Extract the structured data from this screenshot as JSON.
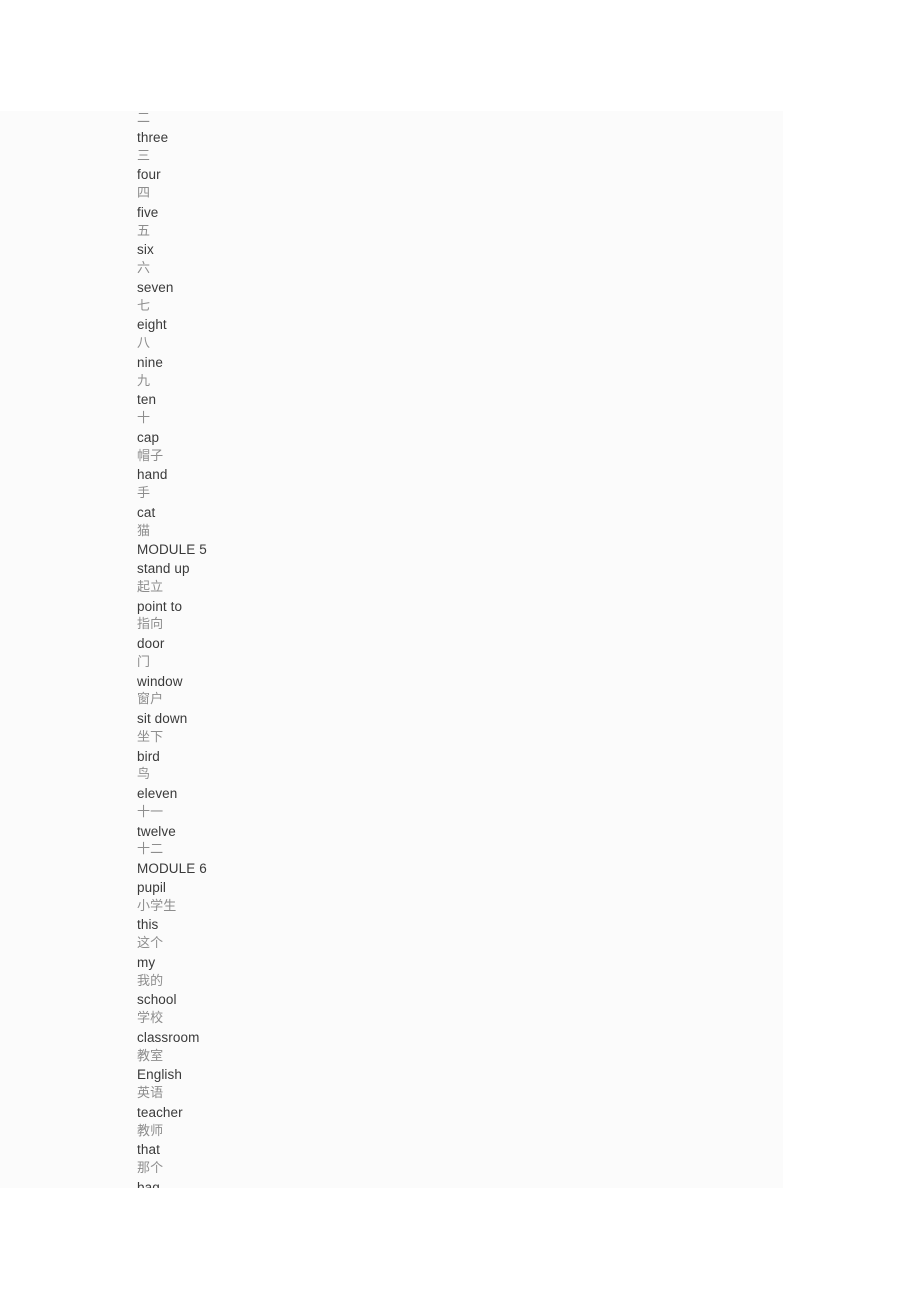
{
  "document": {
    "panel_background": "#fbfbfb",
    "page_background": "#ffffff",
    "term_color": "#3a3a3a",
    "gloss_color": "#8d8d8d",
    "first_line_clipped": true,
    "last_line_clipped": false
  },
  "vocabulary_lines": [
    {
      "text": "二",
      "type": "gloss"
    },
    {
      "text": "three",
      "type": "term"
    },
    {
      "text": "三",
      "type": "gloss"
    },
    {
      "text": "four",
      "type": "term"
    },
    {
      "text": "四",
      "type": "gloss"
    },
    {
      "text": "five",
      "type": "term"
    },
    {
      "text": "五",
      "type": "gloss"
    },
    {
      "text": "six",
      "type": "term"
    },
    {
      "text": "六",
      "type": "gloss"
    },
    {
      "text": "seven",
      "type": "term"
    },
    {
      "text": "七",
      "type": "gloss"
    },
    {
      "text": "eight",
      "type": "term"
    },
    {
      "text": "八",
      "type": "gloss"
    },
    {
      "text": "nine",
      "type": "term"
    },
    {
      "text": "九",
      "type": "gloss"
    },
    {
      "text": "ten",
      "type": "term"
    },
    {
      "text": "十",
      "type": "gloss"
    },
    {
      "text": "cap",
      "type": "term"
    },
    {
      "text": "帽子",
      "type": "gloss"
    },
    {
      "text": "hand",
      "type": "term"
    },
    {
      "text": "手",
      "type": "gloss"
    },
    {
      "text": "cat",
      "type": "term"
    },
    {
      "text": "猫",
      "type": "gloss"
    },
    {
      "text": "MODULE 5",
      "type": "module"
    },
    {
      "text": "stand up",
      "type": "term"
    },
    {
      "text": "起立",
      "type": "gloss"
    },
    {
      "text": "point to",
      "type": "term"
    },
    {
      "text": "指向",
      "type": "gloss"
    },
    {
      "text": "door",
      "type": "term"
    },
    {
      "text": "门",
      "type": "gloss"
    },
    {
      "text": "window",
      "type": "term"
    },
    {
      "text": "窗户",
      "type": "gloss"
    },
    {
      "text": "sit down",
      "type": "term"
    },
    {
      "text": "坐下",
      "type": "gloss"
    },
    {
      "text": "bird",
      "type": "term"
    },
    {
      "text": "鸟",
      "type": "gloss"
    },
    {
      "text": "eleven",
      "type": "term"
    },
    {
      "text": "十一",
      "type": "gloss"
    },
    {
      "text": "twelve",
      "type": "term"
    },
    {
      "text": "十二",
      "type": "gloss"
    },
    {
      "text": "MODULE 6",
      "type": "module"
    },
    {
      "text": "pupil",
      "type": "term"
    },
    {
      "text": "小学生",
      "type": "gloss"
    },
    {
      "text": "this",
      "type": "term"
    },
    {
      "text": "这个",
      "type": "gloss"
    },
    {
      "text": "my",
      "type": "term"
    },
    {
      "text": "我的",
      "type": "gloss"
    },
    {
      "text": "school",
      "type": "term"
    },
    {
      "text": "学校",
      "type": "gloss"
    },
    {
      "text": "classroom",
      "type": "term"
    },
    {
      "text": "教室",
      "type": "gloss"
    },
    {
      "text": "English",
      "type": "term"
    },
    {
      "text": "英语",
      "type": "gloss"
    },
    {
      "text": "teacher",
      "type": "term"
    },
    {
      "text": "教师",
      "type": "gloss"
    },
    {
      "text": "that",
      "type": "term"
    },
    {
      "text": "那个",
      "type": "gloss"
    },
    {
      "text": "bag",
      "type": "term"
    }
  ]
}
